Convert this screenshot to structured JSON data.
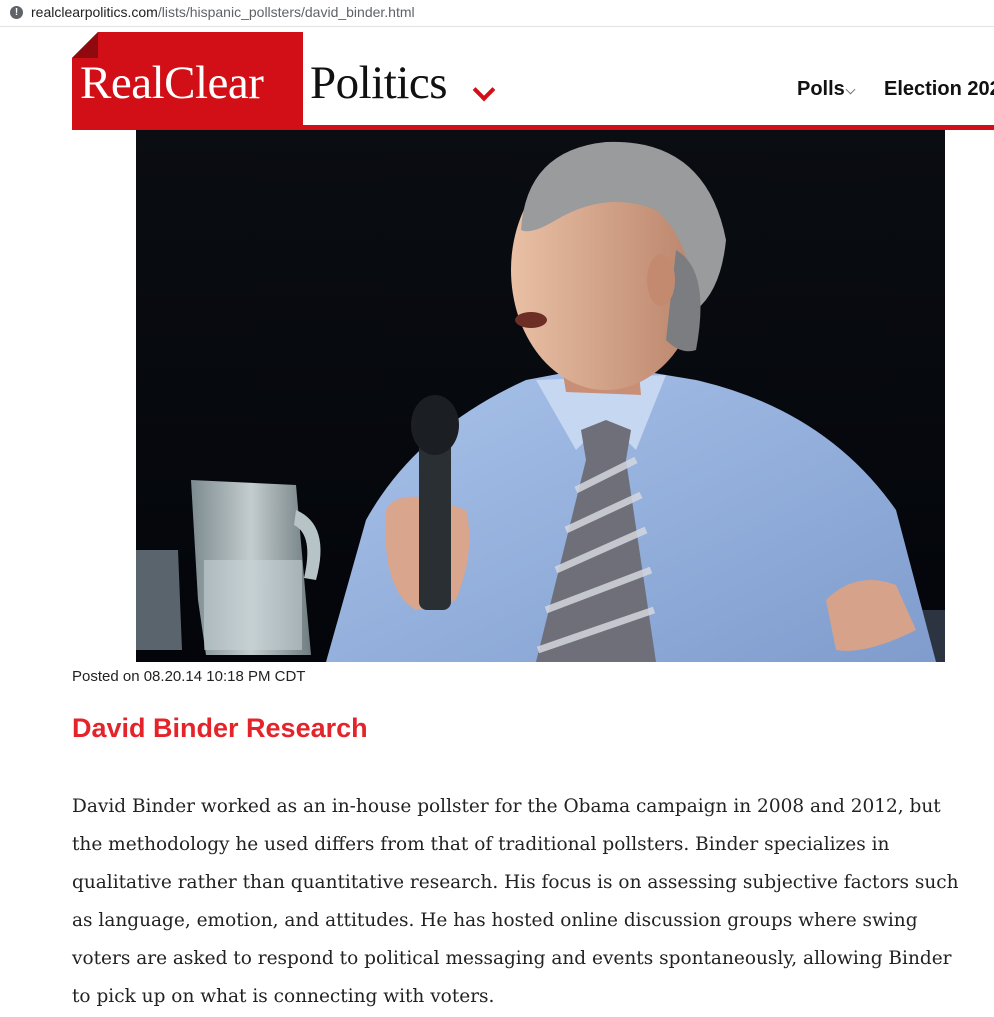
{
  "browser": {
    "url_host": "realclearpolitics.com",
    "url_path": "/lists/hispanic_pollsters/david_binder.html"
  },
  "header": {
    "logo_red": "RealClear",
    "logo_black": "Politics",
    "brand_color": "#d20f16",
    "nav": [
      {
        "label": "Polls"
      },
      {
        "label": "Election 202"
      }
    ]
  },
  "article": {
    "posted": "Posted on 08.20.14 10:18 PM CDT",
    "title": "David Binder Research",
    "title_color": "#e3242b",
    "body_lines": [
      "David Binder worked as an in-house pollster for the Obama campaign in 2008 and 2012, but",
      "the methodology he used differs from that of traditional pollsters. Binder specializes in",
      "qualitative rather than quantitative research. His focus is on assessing subjective factors such",
      "as language, emotion, and attitudes. He has hosted online discussion groups where swing",
      "voters are asked to respond to political messaging and events spontaneously, allowing Binder",
      "to pick up on what is connecting with voters."
    ]
  }
}
